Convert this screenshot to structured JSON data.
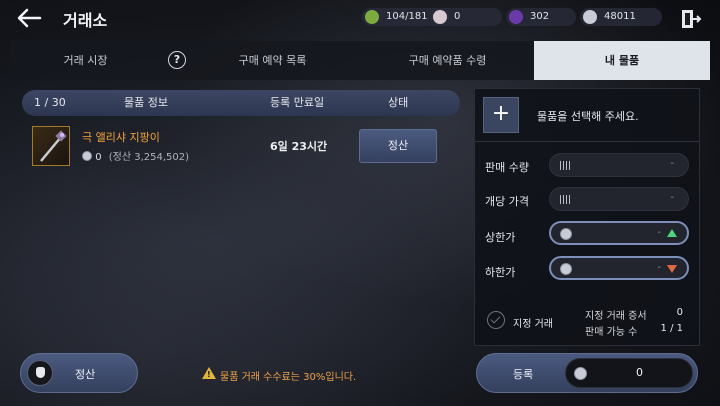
{
  "header": {
    "title": "거래소",
    "resources": [
      {
        "name": "energy",
        "value": "104/181",
        "color": "#8fbf4f"
      },
      {
        "name": "pearl",
        "value": "0",
        "color": "#d8c8d2"
      },
      {
        "name": "crystal",
        "value": "302",
        "color": "#6a3aa8"
      },
      {
        "name": "silver",
        "value": "48011",
        "color": "#c8ccd6"
      }
    ]
  },
  "tabs": [
    {
      "label": "거래 시장",
      "active": false
    },
    {
      "label": "구매 예약 목록",
      "active": false
    },
    {
      "label": "구매 예약품 수령",
      "active": false
    },
    {
      "label": "내 물품",
      "active": true
    }
  ],
  "help_label": "?",
  "list": {
    "count": "1 / 30",
    "columns": [
      "물품 정보",
      "등록 만료일",
      "상태"
    ],
    "items": [
      {
        "name": "극 앨리샤 지팡이",
        "amount": "0",
        "settle_text": "(정산 3,254,502)",
        "expiry": "6일 23시간",
        "action": "정산"
      }
    ]
  },
  "panel": {
    "add_symbol": "+",
    "select_prompt": "물품을 선택해 주세요.",
    "fields": [
      {
        "label": "판매 수량",
        "value": "-"
      },
      {
        "label": "개당 가격",
        "value": "-"
      },
      {
        "label": "상한가",
        "value": "-"
      },
      {
        "label": "하한가",
        "value": "-"
      }
    ],
    "designated_label": "지정 거래",
    "stats": [
      {
        "label": "지정 거래 증서",
        "value": "0"
      },
      {
        "label": "판매 가능 수",
        "value": "1 / 1"
      }
    ]
  },
  "bottom": {
    "settle_label": "정산",
    "notice": "물품 거래 수수료는 30%입니다.",
    "register_label": "등록",
    "register_amount": "0"
  }
}
